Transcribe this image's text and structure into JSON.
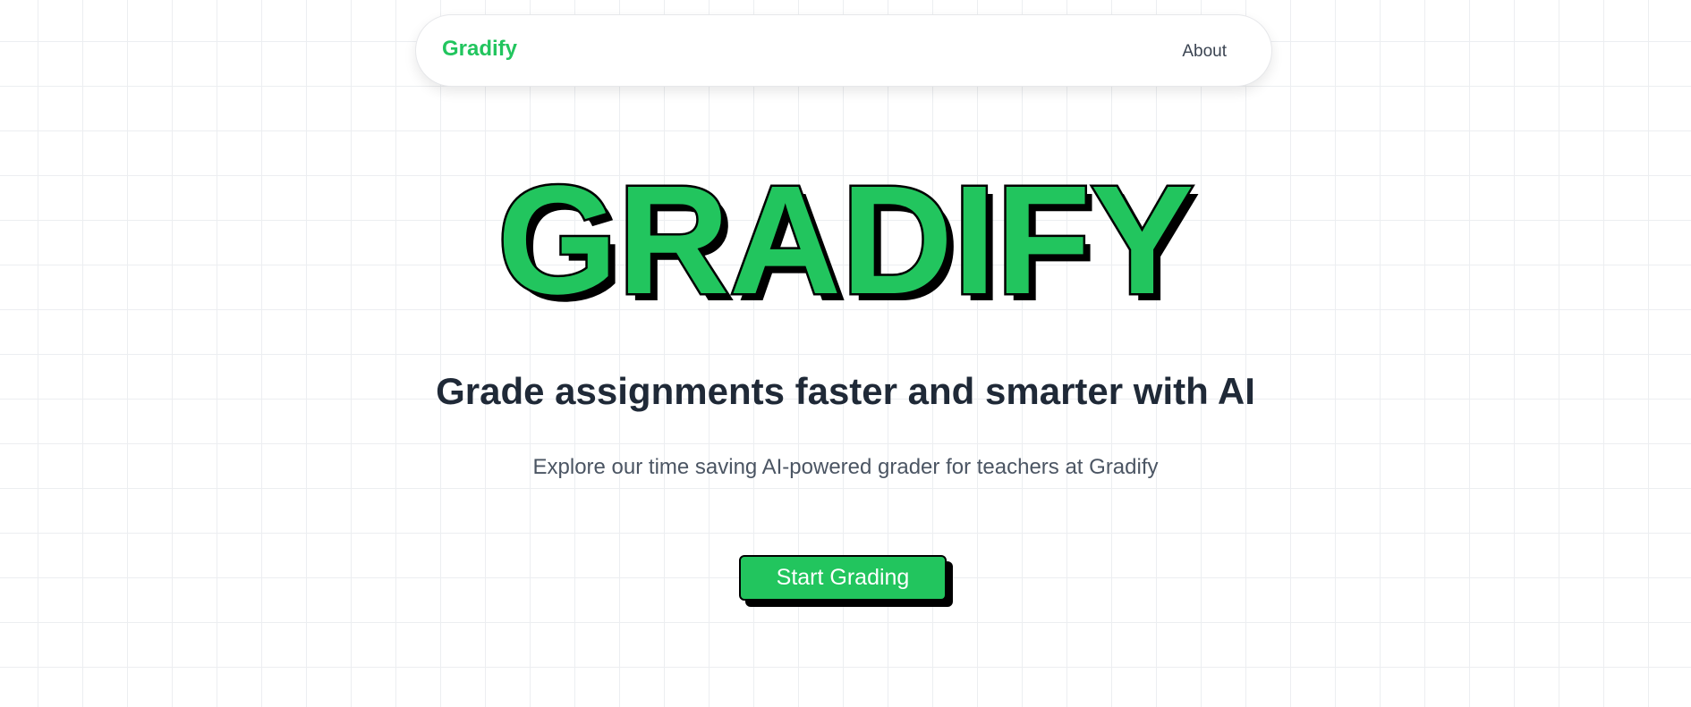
{
  "nav": {
    "brand": "Gradify",
    "links": [
      {
        "label": "About"
      }
    ]
  },
  "hero": {
    "title": "GRADIFY",
    "subtitle": "Grade assignments faster and smarter with AI",
    "description": "Explore our time saving AI-powered grader for teachers at Gradify",
    "cta_label": "Start Grading"
  },
  "colors": {
    "brand_green": "#22c55e",
    "title_outline": "#000000",
    "heading_text": "#1f2937",
    "body_text": "#4b5563",
    "background": "#ffffff",
    "grid_lines": "#eceef1"
  }
}
